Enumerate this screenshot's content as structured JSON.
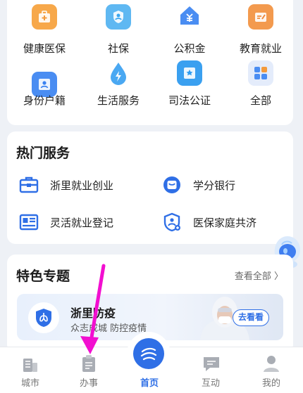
{
  "grid": {
    "items": [
      {
        "label": "健康医保",
        "icon": "medical-kit-icon",
        "color": "#f39a3c"
      },
      {
        "label": "社保",
        "icon": "person-shield-icon",
        "color": "#3aa6f0"
      },
      {
        "label": "公积金",
        "icon": "house-yen-icon",
        "color": "#3b82f0"
      },
      {
        "label": "教育就业",
        "icon": "graduation-icon",
        "color": "#f08a3c"
      },
      {
        "label": "身份户籍",
        "icon": "id-card-icon",
        "color": "#3b82f0"
      },
      {
        "label": "生活服务",
        "icon": "water-drop-icon",
        "color": "#3aa6f0"
      },
      {
        "label": "司法公证",
        "icon": "certificate-icon",
        "color": "#2f9df0"
      },
      {
        "label": "全部",
        "icon": "apps-grid-icon",
        "color": "#3b82f0"
      }
    ]
  },
  "hot": {
    "title": "热门服务",
    "items": [
      {
        "label": "浙里就业创业",
        "icon": "briefcase-icon"
      },
      {
        "label": "学分银行",
        "icon": "bank-icon"
      },
      {
        "label": "灵活就业登记",
        "icon": "registration-card-icon"
      },
      {
        "label": "医保家庭共济",
        "icon": "family-shield-icon"
      }
    ]
  },
  "topics": {
    "title": "特色专题",
    "more_label": "查看全部 〉",
    "banner": {
      "title": "浙里防疫",
      "subtitle": "众志成城 防控疫情",
      "button_label": "去看看"
    }
  },
  "tabbar": {
    "tabs": [
      {
        "label": "城市",
        "icon": "city-icon"
      },
      {
        "label": "办事",
        "icon": "document-icon"
      },
      {
        "label": "首页",
        "icon": "home-logo-icon"
      },
      {
        "label": "互动",
        "icon": "chat-icon"
      },
      {
        "label": "我的",
        "icon": "user-icon"
      }
    ],
    "active": "首页"
  },
  "colors": {
    "accent": "#2f6fe6",
    "arrow": "#f20fd0"
  }
}
